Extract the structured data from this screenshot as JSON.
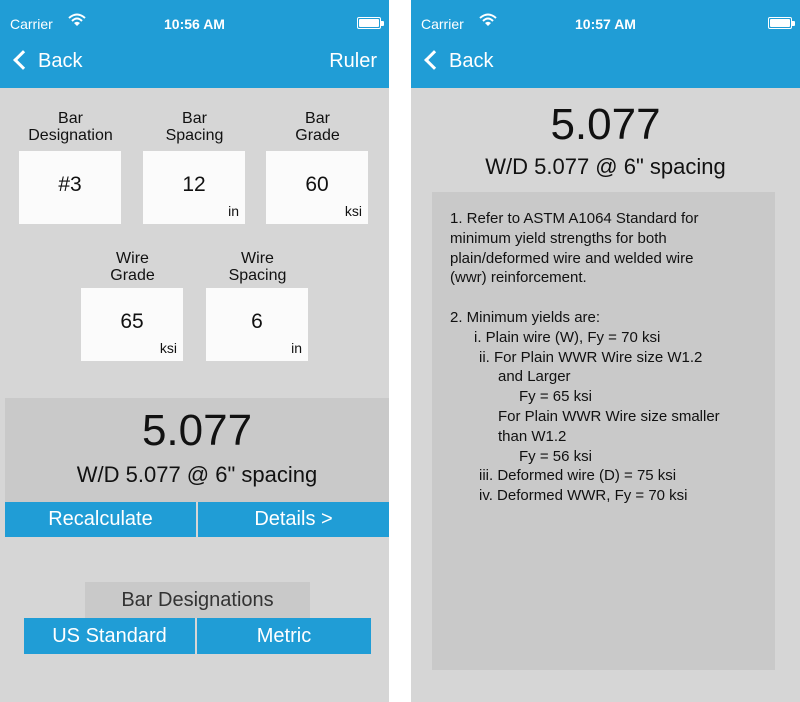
{
  "left_screen": {
    "status": {
      "carrier": "Carrier",
      "time": "10:56 AM"
    },
    "nav": {
      "back": "Back",
      "ruler": "Ruler"
    },
    "inputs": {
      "bar_designation": {
        "label_line1": "Bar",
        "label_line2": "Designation",
        "value": "#3",
        "unit": ""
      },
      "bar_spacing": {
        "label_line1": "Bar",
        "label_line2": "Spacing",
        "value": "12",
        "unit": "in"
      },
      "bar_grade": {
        "label_line1": "Bar",
        "label_line2": "Grade",
        "value": "60",
        "unit": "ksi"
      },
      "wire_grade": {
        "label_line1": "Wire",
        "label_line2": "Grade",
        "value": "65",
        "unit": "ksi"
      },
      "wire_spacing": {
        "label_line1": "Wire",
        "label_line2": "Spacing",
        "value": "6",
        "unit": "in"
      }
    },
    "result": {
      "value": "5.077",
      "description": "W/D 5.077 @ 6\" spacing"
    },
    "buttons": {
      "recalculate": "Recalculate",
      "details": "Details >"
    },
    "bar_designations": {
      "header": "Bar Designations",
      "us_standard": "US Standard",
      "metric": "Metric"
    }
  },
  "right_screen": {
    "status": {
      "carrier": "Carrier",
      "time": "10:57 AM"
    },
    "nav": {
      "back": "Back"
    },
    "result": {
      "value": "5.077",
      "description": "W/D 5.077 @ 6\" spacing"
    },
    "details_lines": [
      "1. Refer to ASTM A1064 Standard for",
      "minimum yield strengths for both",
      "plain/deformed wire and welded wire",
      "(wwr) reinforcement.",
      "",
      "2. Minimum yields are:",
      "i. Plain wire (W), Fy = 70 ksi",
      "ii. For Plain WWR Wire size W1.2",
      "and Larger",
      "Fy = 65 ksi",
      "For Plain WWR Wire size smaller",
      "than W1.2",
      "Fy = 56 ksi",
      "iii. Deformed wire (D) = 75 ksi",
      "iv. Deformed WWR, Fy = 70 ksi"
    ]
  },
  "colors": {
    "accent": "#209dd6",
    "background": "#d6d6d6",
    "panel": "#c9c9c9",
    "field": "#fbfbfb"
  },
  "icons": [
    "wifi-icon",
    "battery-icon",
    "back-chevron-icon"
  ]
}
